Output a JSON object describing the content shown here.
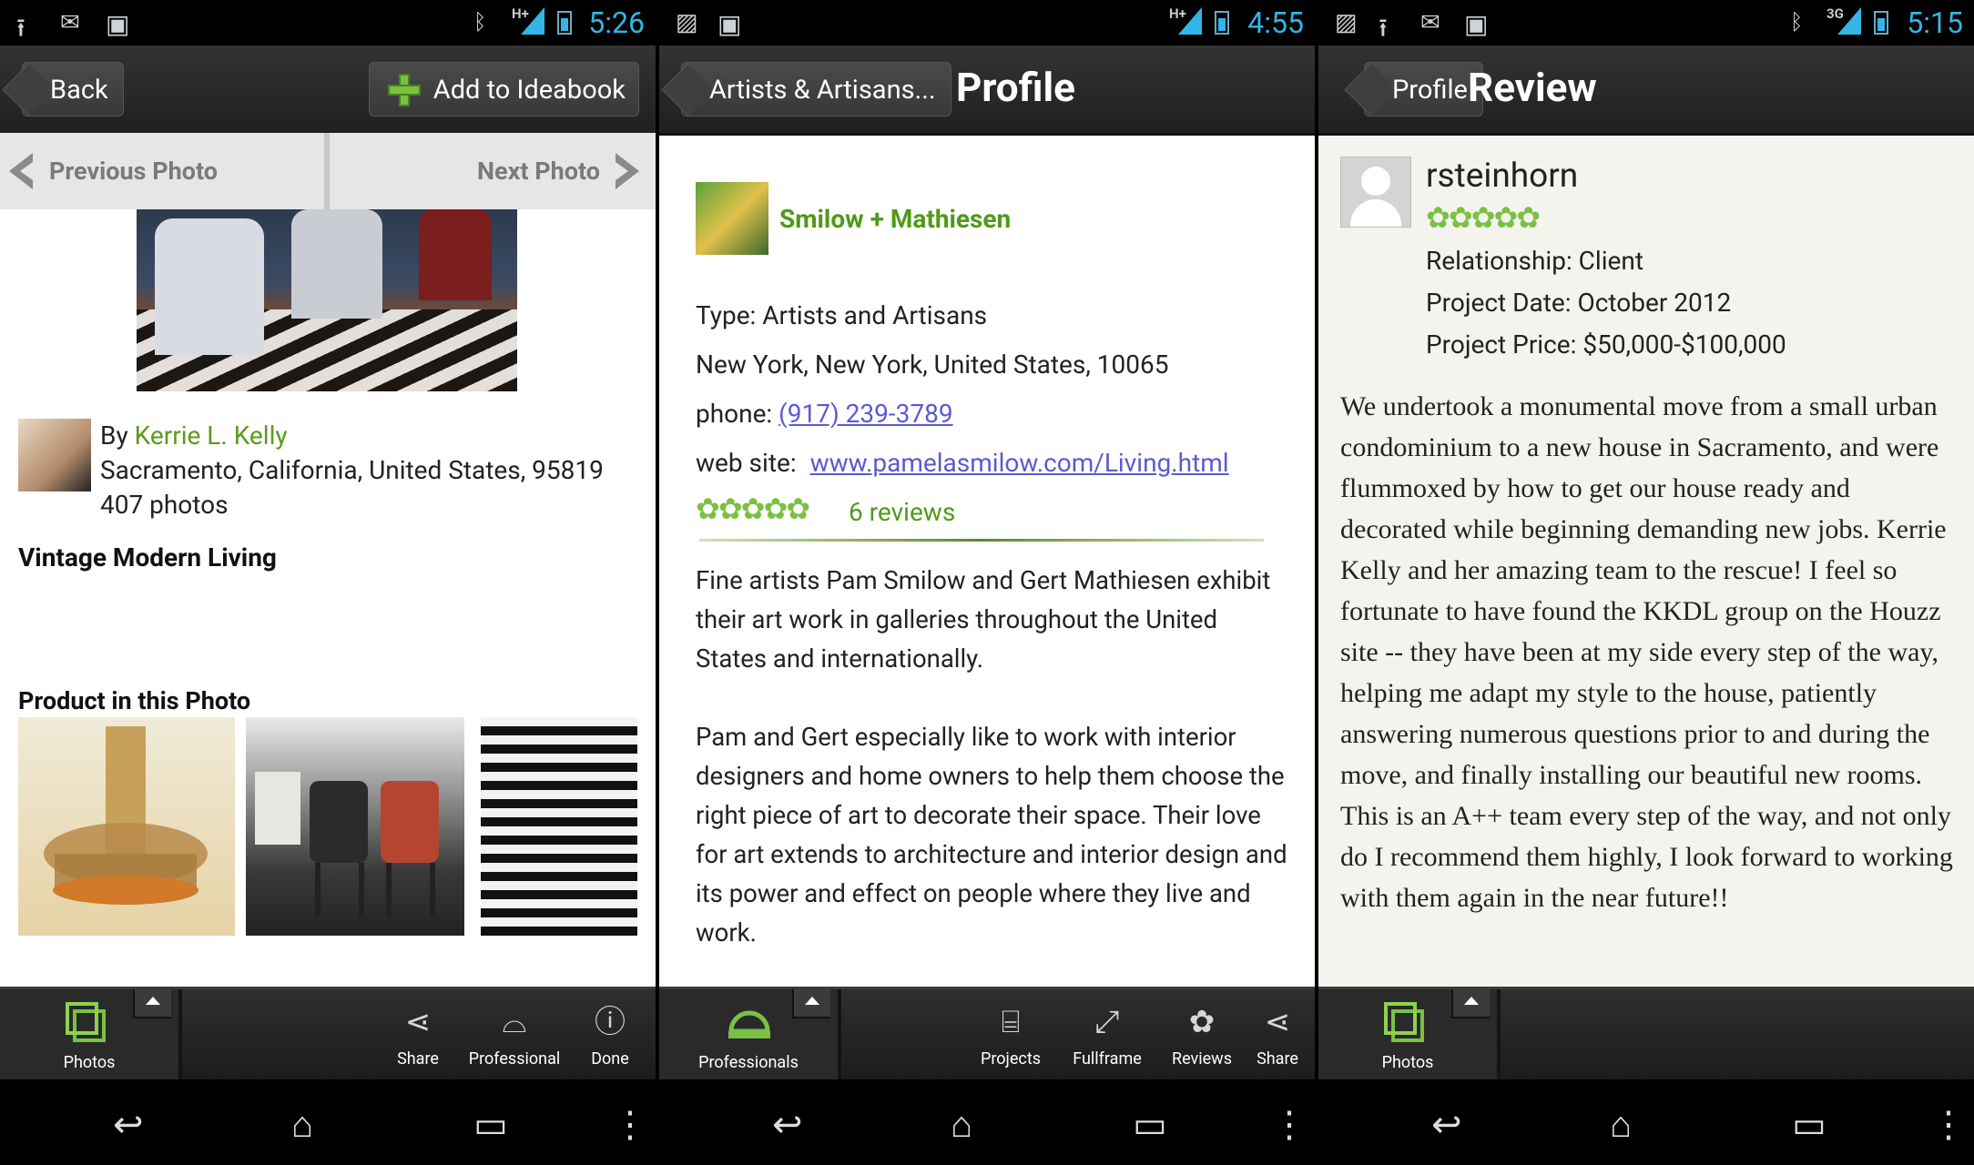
{
  "screens": {
    "photo": {
      "status": {
        "time": "5:26",
        "network": "H+"
      },
      "actionbar": {
        "back": "Back",
        "add": "Add to Ideabook"
      },
      "photonav": {
        "prev": "Previous Photo",
        "next": "Next Photo"
      },
      "author": {
        "by_prefix": "By",
        "name": "Kerrie L. Kelly",
        "location": "Sacramento, California, United States, 95819",
        "photos": "407 photos"
      },
      "title": "Vintage Modern Living",
      "products_heading": "Product in this Photo",
      "bottombar": {
        "tab": "Photos",
        "items": [
          "Share",
          "Professional",
          "Done"
        ]
      }
    },
    "profile": {
      "status": {
        "time": "4:55",
        "network": "H+"
      },
      "actionbar": {
        "back": "Artists & Artisans...",
        "title": "Profile"
      },
      "name": "Smilow + Mathiesen",
      "type": "Type: Artists and Artisans",
      "address": "New York, New York, United States, 10065",
      "phone_label": "phone:",
      "phone": "(917) 239-3789",
      "web_label": "web site:",
      "web": "www.pamelasmilow.com/Living.html",
      "rating_stars": 5,
      "reviews": "6 reviews",
      "para1": "Fine artists Pam Smilow and Gert Mathiesen exhibit their art work in galleries throughout the United States and internationally.",
      "para2": "Pam and Gert especially like to work with interior designers and home owners to help them choose the right piece of art to decorate their space. Their love for art extends to architecture and interior design and its power and effect on people where they live and work.",
      "bottombar": {
        "tab": "Professionals",
        "items": [
          "Projects",
          "Fullframe",
          "Reviews",
          "Share"
        ]
      }
    },
    "review": {
      "status": {
        "time": "5:15",
        "network": "3G"
      },
      "actionbar": {
        "back": "Profile",
        "title": "Review"
      },
      "reviewer": "rsteinhorn",
      "rating_stars": 5,
      "relationship": "Relationship: Client",
      "project_date": "Project Date: October 2012",
      "project_price": "Project Price: $50,000-$100,000",
      "body": "We undertook a monumental move from a small urban condominium to a new house in Sacramento, and were flummoxed by how to get our house ready and decorated while beginning demanding new jobs. Kerrie Kelly and her amazing team to the rescue! I feel so fortunate to have found the KKDL group on the Houzz site -- they have been at my side every step of the way, helping me adapt my style to the house, patiently answering numerous questions prior to and during the move, and finally installing our beautiful new rooms. This is an A++ team every step of the way, and not only do I recommend them highly, I look forward to working with them again in the near future!!",
      "bottombar": {
        "tab": "Photos"
      }
    }
  },
  "colors": {
    "accent_green": "#7ac142",
    "link_blue": "#5a5ad4",
    "status_blue": "#33b5e5"
  }
}
